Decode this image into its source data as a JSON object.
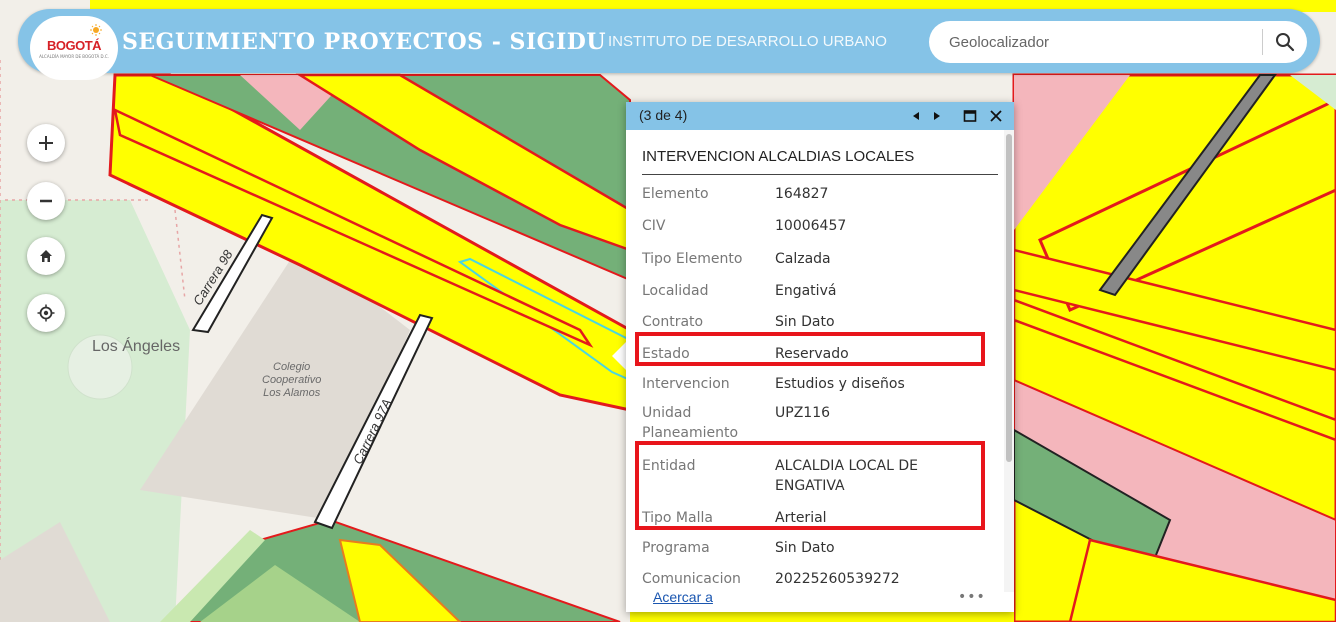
{
  "header": {
    "logo_text": "BOGOTÁ",
    "logo_subtext": "ALCALDÍA MAYOR DE BOGOTÁ D.C.",
    "title": "SEGUIMIENTO PROYECTOS - SIGIDU",
    "subtitle": "INSTITUTO DE DESARROLLO URBANO",
    "search": {
      "placeholder": "Geolocalizador",
      "value": ""
    }
  },
  "map_controls": [
    {
      "name": "zoom-in-button",
      "icon": "plus-icon"
    },
    {
      "name": "zoom-out-button",
      "icon": "minus-icon"
    },
    {
      "name": "home-button",
      "icon": "home-icon"
    },
    {
      "name": "locate-button",
      "icon": "target-icon"
    }
  ],
  "map_labels": {
    "neighborhood": "Los Ángeles",
    "school_line1": "Colegio",
    "school_line2": "Cooperativo",
    "school_line3": "Los Alamos",
    "street_1": "Carrera 98",
    "street_2": "Carrera 97A"
  },
  "popup": {
    "count": "(3 de 4)",
    "title": "INTERVENCION ALCALDIAS LOCALES",
    "attributes": [
      {
        "key": "Elemento",
        "value": "164827"
      },
      {
        "key": "CIV",
        "value": "10006457"
      },
      {
        "key": "Tipo Elemento",
        "value": "Calzada"
      },
      {
        "key": "Localidad",
        "value": "Engativá"
      },
      {
        "key": "Contrato",
        "value": "Sin Dato"
      },
      {
        "key": "Estado",
        "value": "Reservado"
      },
      {
        "key": "Intervencion",
        "value": "Estudios y diseños"
      },
      {
        "key": "Unidad Planeamiento",
        "value": "UPZ116"
      },
      {
        "key": "Entidad",
        "value": "ALCALDIA LOCAL DE ENGATIVA"
      },
      {
        "key": "Tipo Malla",
        "value": "Arterial"
      },
      {
        "key": "Programa",
        "value": "Sin Dato"
      },
      {
        "key": "Comunicacion",
        "value": "20225260539272"
      }
    ],
    "zoom_link": "Acercar a",
    "more": "•••"
  },
  "colors": {
    "header": "#85c3e7",
    "road_yellow": "#ffff00",
    "parcel_red": "#e31a1c",
    "green_area": "#74b078",
    "pink_area": "#f4b6bc",
    "highlight": "#e8151b"
  }
}
